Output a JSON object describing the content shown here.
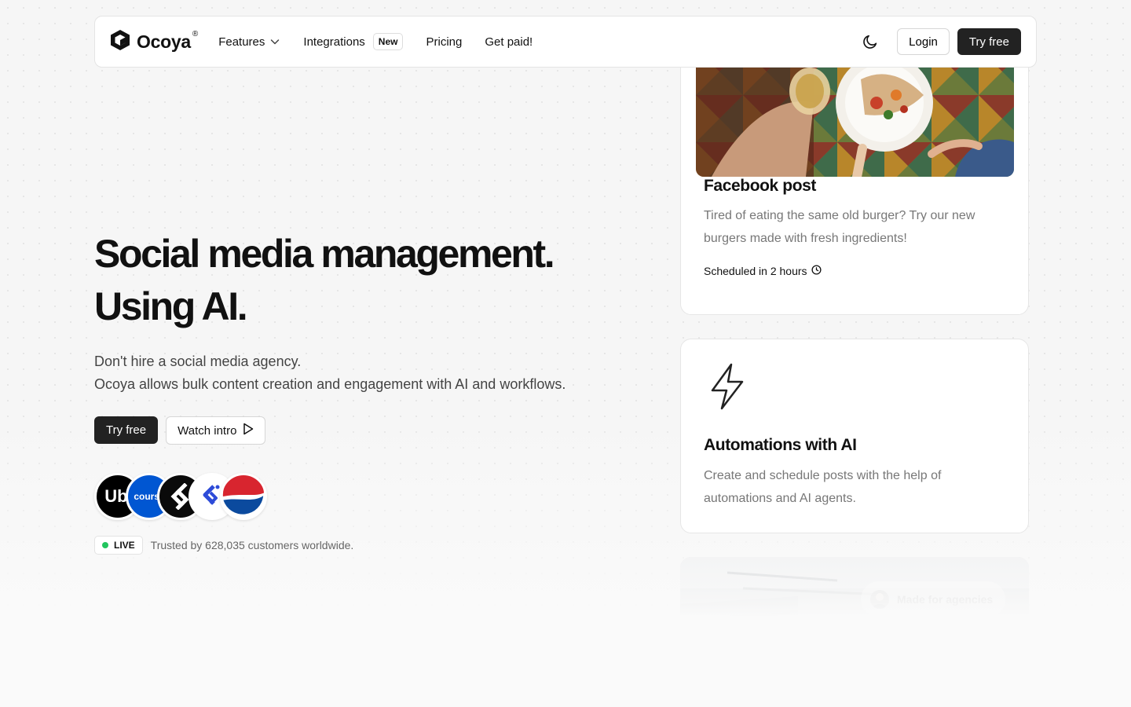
{
  "nav": {
    "logo": "Ocoya",
    "logo_reg": "®",
    "links": [
      {
        "label": "Features"
      },
      {
        "label": "Integrations",
        "badge": "New"
      },
      {
        "label": "Pricing"
      },
      {
        "label": "Get paid!"
      }
    ],
    "login": "Login",
    "cta": "Try free"
  },
  "hero": {
    "title_line1": "Social media management.",
    "title_line2": "Using AI.",
    "sub_line1": "Don't hire a social media agency.",
    "sub_line2": "Ocoya allows bulk content creation and engagement with AI and workflows.",
    "cta_primary": "Try free",
    "cta_secondary": "Watch intro",
    "brands": [
      {
        "name": "Uber",
        "label": "Ube",
        "color": "#000000"
      },
      {
        "name": "Coursera",
        "label": "course",
        "color": "#0056d2"
      },
      {
        "name": "Brand 3",
        "color": "#0a0a0a"
      },
      {
        "name": "Brand 4",
        "color": "#ffffff"
      },
      {
        "name": "Pepsi",
        "color": "#ffffff"
      }
    ],
    "live_label": "LIVE",
    "trusted": "Trusted by 628,035 customers worldwide."
  },
  "cards": {
    "facebook": {
      "title": "Facebook post",
      "text": "Tired of eating the same old burger? Try our new burgers made with fresh ingredients!",
      "scheduled": "Scheduled in 2 hours"
    },
    "automations": {
      "title": "Automations with AI",
      "text": "Create and schedule posts with the help of automations and AI agents."
    },
    "agencies": {
      "label": "Made for agencies"
    }
  },
  "colors": {
    "primary_dark": "#222222",
    "live_green": "#22c55e"
  }
}
